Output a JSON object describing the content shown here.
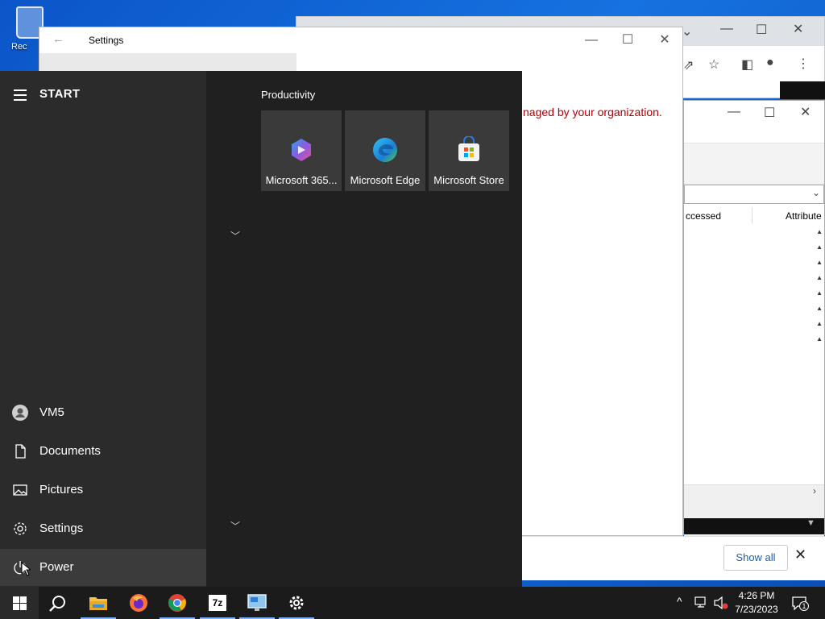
{
  "desktop": {
    "recycle_bin_label": "Rec"
  },
  "settings_window": {
    "title": "Settings",
    "managed_message": "naged by your organization."
  },
  "explorer_window": {
    "col_accessed": "ccessed",
    "col_attributes": "Attribute"
  },
  "notification": {
    "show_all_label": "Show all"
  },
  "start_menu": {
    "title": "START",
    "group_title": "Productivity",
    "tiles": [
      {
        "label": "Microsoft 365...",
        "icon": "microsoft-365-icon"
      },
      {
        "label": "Microsoft Edge",
        "icon": "edge-icon"
      },
      {
        "label": "Microsoft Store",
        "icon": "store-icon"
      }
    ],
    "rail": {
      "user": "VM5",
      "documents": "Documents",
      "pictures": "Pictures",
      "settings": "Settings",
      "power": "Power"
    }
  },
  "taskbar": {
    "apps": [
      "start-icon",
      "search-icon",
      "file-explorer-icon",
      "firefox-icon",
      "chrome-icon",
      "7zip-icon",
      "remote-desktop-icon",
      "settings-icon"
    ],
    "time": "4:26 PM",
    "date": "7/23/2023",
    "notification_count": "1"
  },
  "colors": {
    "start_bg": "#202020",
    "rail_bg": "#2b2b2b",
    "tile_bg": "#3a3a3a",
    "taskbar_bg": "#1b1b1b",
    "managed_text": "#b00000",
    "desktop_blue": "#1672e0"
  }
}
